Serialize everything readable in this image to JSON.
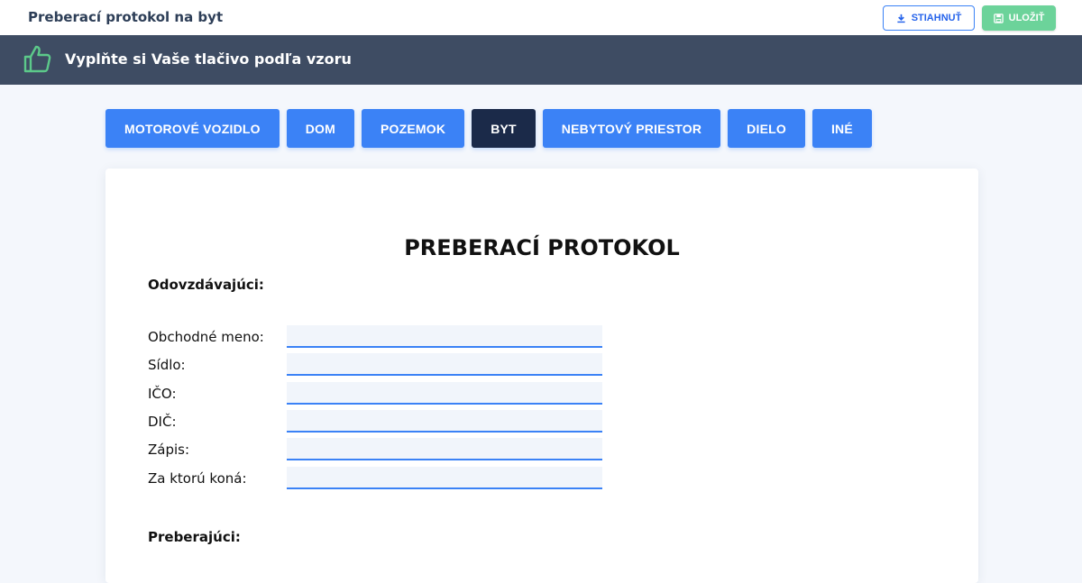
{
  "header": {
    "title": "Preberací protokol na byt",
    "download_label": "STIAHNUŤ",
    "save_label": "ULOŽIŤ"
  },
  "banner": {
    "text": "Vyplňte si Vaše tlačivo podľa vzoru",
    "icon": "thumbs-up-icon"
  },
  "tabs": [
    {
      "label": "MOTOROVÉ VOZIDLO",
      "active": false
    },
    {
      "label": "DOM",
      "active": false
    },
    {
      "label": "POZEMOK",
      "active": false
    },
    {
      "label": "BYT",
      "active": true
    },
    {
      "label": "NEBYTOVÝ PRIESTOR",
      "active": false
    },
    {
      "label": "DIELO",
      "active": false
    },
    {
      "label": "INÉ",
      "active": false
    }
  ],
  "document": {
    "title": "PREBERACÍ PROTOKOL",
    "section_handover": "Odovzdávajúci:",
    "fields": [
      {
        "label": "Obchodné meno:",
        "value": ""
      },
      {
        "label": "Sídlo:",
        "value": ""
      },
      {
        "label": "IČO:",
        "value": ""
      },
      {
        "label": "DIČ:",
        "value": ""
      },
      {
        "label": "Zápis:",
        "value": ""
      },
      {
        "label": "Za ktorú koná:",
        "value": ""
      }
    ],
    "section_receiver": "Preberajúci:"
  },
  "colors": {
    "accent": "#3b82f6",
    "active_tab": "#1b2a49",
    "banner": "#3e4c63",
    "save": "#6cd39a",
    "thumb": "#5cc98a"
  }
}
